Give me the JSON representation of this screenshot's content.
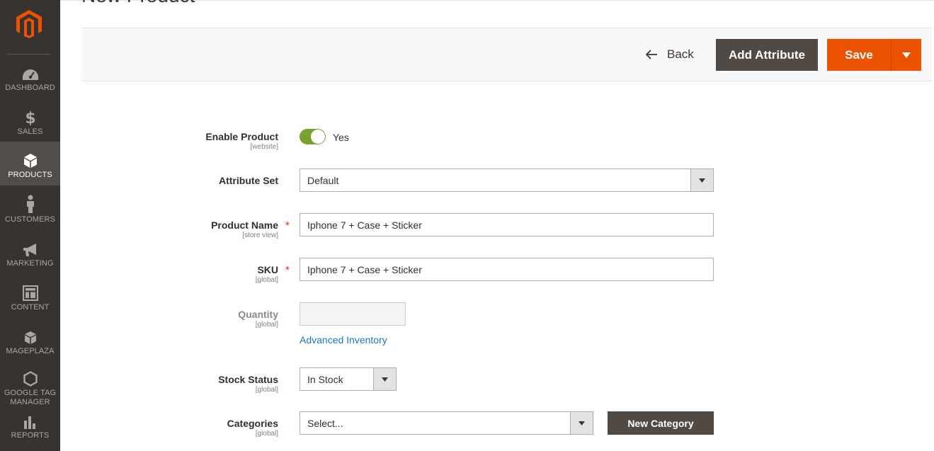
{
  "page": {
    "title": "New Product"
  },
  "sidebar": {
    "items": [
      {
        "label": "DASHBOARD"
      },
      {
        "label": "SALES"
      },
      {
        "label": "PRODUCTS"
      },
      {
        "label": "CUSTOMERS"
      },
      {
        "label": "MARKETING"
      },
      {
        "label": "CONTENT"
      },
      {
        "label": "MAGEPLAZA"
      },
      {
        "label": "GOOGLE TAG MANAGER"
      },
      {
        "label": "REPORTS"
      }
    ],
    "active_item": "PRODUCTS"
  },
  "toolbar": {
    "back_label": "Back",
    "add_attribute_label": "Add Attribute",
    "save_label": "Save"
  },
  "form": {
    "enable_product": {
      "label": "Enable Product",
      "scope": "[website]",
      "value_text": "Yes",
      "enabled": true
    },
    "attribute_set": {
      "label": "Attribute Set",
      "value": "Default"
    },
    "product_name": {
      "label": "Product Name",
      "scope": "[store view]",
      "value": "Iphone 7 + Case + Sticker",
      "required_mark": "*"
    },
    "sku": {
      "label": "SKU",
      "scope": "[global]",
      "value": "Iphone 7 + Case + Sticker",
      "required_mark": "*"
    },
    "quantity": {
      "label": "Quantity",
      "scope": "[global]",
      "value": ""
    },
    "advanced_inventory_link": "Advanced Inventory",
    "stock_status": {
      "label": "Stock Status",
      "scope": "[global]",
      "value": "In Stock"
    },
    "categories": {
      "label": "Categories",
      "scope": "[global]",
      "placeholder": "Select...",
      "new_category_label": "New Category"
    }
  },
  "colors": {
    "sidebar_bg": "#373330",
    "sidebar_active": "#524d49",
    "brand_orange": "#eb5202",
    "dark_button": "#514943",
    "toggle_on": "#79a22e",
    "link_blue": "#1979c3",
    "required_red": "#e22626"
  },
  "icons": {
    "logo": "magento-logo-icon",
    "dashboard": "speedometer-icon",
    "sales": "dollar-icon",
    "products": "cube-icon",
    "customers": "person-icon",
    "marketing": "megaphone-icon",
    "content": "layout-icon",
    "mageplaza": "box-icon",
    "google_tag_manager": "hexagon-icon",
    "reports": "bar-chart-icon",
    "back": "arrow-left-icon",
    "dropdown": "caret-down-icon"
  }
}
